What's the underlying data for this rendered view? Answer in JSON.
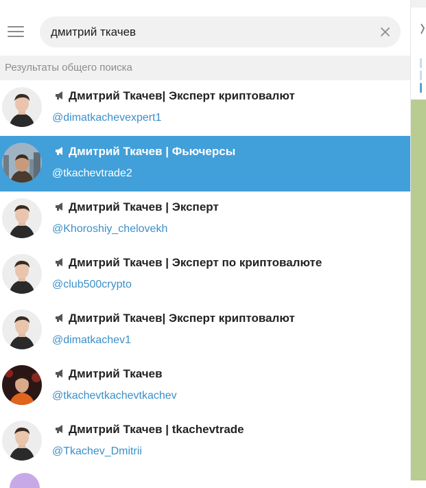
{
  "search": {
    "query": "дмитрий ткачев"
  },
  "section_title": "Результаты общего поиска",
  "results": [
    {
      "name": "Дмитрий Ткачев| Эксперт криптовалют",
      "username": "@dimatkachevexpert1"
    },
    {
      "name": "Дмитрий Ткачев | Фьючерсы",
      "username": "@tkachevtrade2"
    },
    {
      "name": "Дмитрий Ткачев | Эксперт",
      "username": "@Khoroshiy_chelovekh"
    },
    {
      "name": "Дмитрий Ткачев | Эксперт по криптовалюте",
      "username": "@club500crypto"
    },
    {
      "name": "Дмитрий Ткачев| Эксперт криптовалют",
      "username": "@dimatkachev1"
    },
    {
      "name": "Дмитрий Ткачев",
      "username": "@tkachevtkachevtkachev"
    },
    {
      "name": "Дмитрий Ткачев | tkachevtrade",
      "username": "@Tkachev_Dmitrii"
    }
  ],
  "colors": {
    "accent": "#419fd9",
    "username": "#3a8fc9",
    "chat_bg": "#b8cc92"
  },
  "icons": {
    "menu": "hamburger-icon",
    "clear": "close-icon",
    "channel": "megaphone-icon"
  }
}
